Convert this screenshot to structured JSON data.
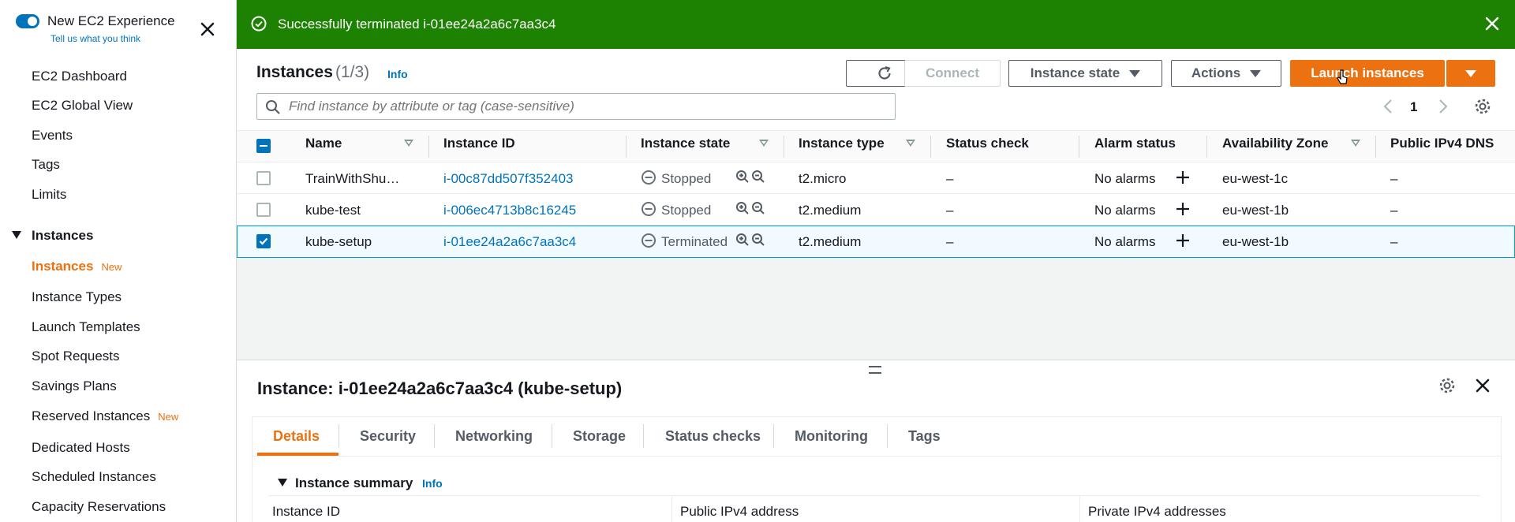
{
  "sidebar": {
    "experience_title": "New EC2 Experience",
    "experience_link": "Tell us what you think",
    "items": [
      {
        "label": "EC2 Dashboard"
      },
      {
        "label": "EC2 Global View"
      },
      {
        "label": "Events"
      },
      {
        "label": "Tags"
      },
      {
        "label": "Limits"
      }
    ],
    "section_label": "Instances",
    "section_items": [
      {
        "label": "Instances",
        "badge": "New",
        "active": true
      },
      {
        "label": "Instance Types"
      },
      {
        "label": "Launch Templates"
      },
      {
        "label": "Spot Requests"
      },
      {
        "label": "Savings Plans"
      },
      {
        "label": "Reserved Instances",
        "badge": "New"
      },
      {
        "label": "Dedicated Hosts"
      },
      {
        "label": "Scheduled Instances"
      },
      {
        "label": "Capacity Reservations"
      }
    ]
  },
  "flash": {
    "message": "Successfully terminated i-01ee24a2a6c7aa3c4",
    "color": "#1d8102"
  },
  "header": {
    "title": "Instances",
    "count": "(1/3)",
    "info": "Info",
    "connect_label": "Connect",
    "instance_state_label": "Instance state",
    "actions_label": "Actions",
    "launch_label": "Launch instances",
    "accent": "#ec7211"
  },
  "search": {
    "placeholder": "Find instance by attribute or tag (case-sensitive)",
    "value": ""
  },
  "pagination": {
    "page": "1"
  },
  "table": {
    "columns": [
      "Name",
      "Instance ID",
      "Instance state",
      "Instance type",
      "Status check",
      "Alarm status",
      "Availability Zone",
      "Public IPv4 DNS"
    ],
    "rows": [
      {
        "name": "TrainWithShu…",
        "id": "i-00c87dd507f352403",
        "state": "Stopped",
        "type": "t2.micro",
        "status": "–",
        "alarm": "No alarms",
        "zone": "eu-west-1c",
        "dns": "–",
        "selected": false
      },
      {
        "name": "kube-test",
        "id": "i-006ec4713b8c16245",
        "state": "Stopped",
        "type": "t2.medium",
        "status": "–",
        "alarm": "No alarms",
        "zone": "eu-west-1b",
        "dns": "–",
        "selected": false
      },
      {
        "name": "kube-setup",
        "id": "i-01ee24a2a6c7aa3c4",
        "state": "Terminated",
        "type": "t2.medium",
        "status": "–",
        "alarm": "No alarms",
        "zone": "eu-west-1b",
        "dns": "–",
        "selected": true
      }
    ]
  },
  "details": {
    "title": "Instance: i-01ee24a2a6c7aa3c4 (kube-setup)",
    "tabs": [
      {
        "label": "Details",
        "active": true
      },
      {
        "label": "Security"
      },
      {
        "label": "Networking"
      },
      {
        "label": "Storage"
      },
      {
        "label": "Status checks"
      },
      {
        "label": "Monitoring"
      },
      {
        "label": "Tags"
      }
    ],
    "summary_label": "Instance summary",
    "summary_info": "Info",
    "fields": [
      "Instance ID",
      "Public IPv4 address",
      "Private IPv4 addresses"
    ]
  }
}
